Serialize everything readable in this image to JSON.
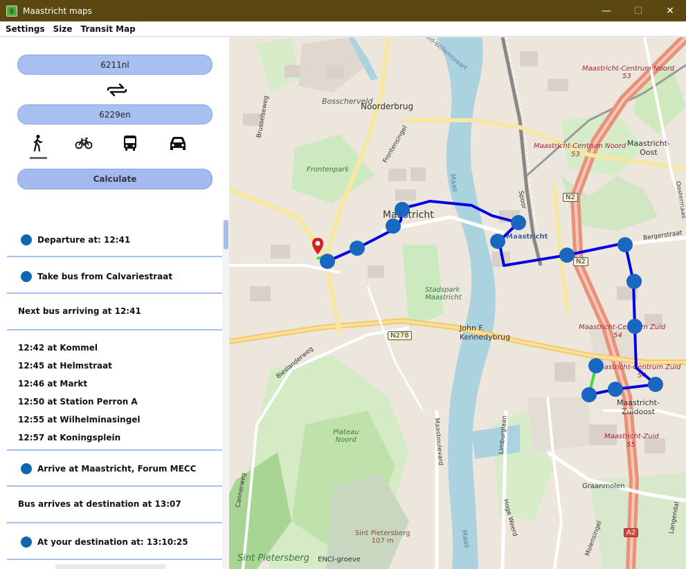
{
  "window": {
    "title": "Maastricht maps",
    "minimize": "—",
    "maximize": "☐",
    "close": "✕"
  },
  "menu": {
    "items": [
      "Settings",
      "Size",
      "Transit Map"
    ]
  },
  "form": {
    "from_value": "6211nl",
    "to_value": "6229en",
    "swap_icon": "swap-arrows-icon",
    "modes": [
      {
        "name": "walk",
        "icon": "walking-person-icon",
        "selected": true
      },
      {
        "name": "bike",
        "icon": "bicycle-icon",
        "selected": false
      },
      {
        "name": "bus",
        "icon": "bus-icon",
        "selected": false
      },
      {
        "name": "car",
        "icon": "car-icon",
        "selected": false
      }
    ],
    "calculate_label": "Calculate"
  },
  "itinerary": {
    "departure": "Departure at: 12:41",
    "take_bus": "Take bus from Calvariestraat",
    "next_bus": "Next bus arriving at 12:41",
    "stops": [
      "12:42 at Kommel",
      "12:45 at Helmstraat",
      "12:46 at Markt",
      "12:50 at Station Perron A",
      "12:55 at Wilhelminasingel",
      "12:57 at Koningsplein"
    ],
    "arrive": "Arrive at Maastricht, Forum MECC",
    "bus_arrives": "Bus arrives at destination at 13:07",
    "destination": "At your destination at: 13:10:25",
    "dot_color": "#1166b3",
    "separator_color": "#a8bff2"
  },
  "map": {
    "labels": {
      "bosscherveld": "Bosscherveld",
      "noorderbrug": "Noorderbrug",
      "maastricht": "Maastricht",
      "maastricht_station": "Maastricht",
      "frontenpark": "Frontenpark",
      "frontensingel": "Frontensingel",
      "brusselseweg": "Brusselseweg",
      "centrum_noord_top": "Maastricht-Centrum Noord",
      "centrum_noord_top_num": "53",
      "centrum_noord": "Maastricht-Centrum Noord",
      "centrum_noord_num": "53",
      "maastricht_oost": "Maastricht-\nOost",
      "bergerstraat": "Bergerstraat",
      "oostermaas": "Oostermaas",
      "maas1": "Maas",
      "maas2": "Maas",
      "stadspark": "Stadspark\nMaastricht",
      "john_f": "John F.\nKennedybrug",
      "bieslanderweg": "Bieslanderweg",
      "centrum_zuid_1": "Maastricht-Centrum Zuid",
      "centrum_zuid_1_num": "54",
      "centrum_zuid_2": "Maastricht-Centrum Zuid",
      "centrum_zuid_2_num": "54",
      "zuidoost": "Maastricht-\nZuidoost",
      "maastricht_zuid": "Maastricht-Zuid",
      "maastricht_zuid_num": "55",
      "plateau": "Plateau\nNoord",
      "maasboulevard": "Maasboulevard",
      "limburglaan": "Limburglaan",
      "graanmolen": "Graanmolen",
      "hoge_weerd": "Hoge Weerd",
      "sint_pietersberg_peak": "Sint Pietersberg\n107 m",
      "sint_pietersberg": "Sint Pietersberg",
      "enci": "ENCI-groeve",
      "cannerweg": "Cannerweg",
      "langendal": "Langendal",
      "molensingel": "Molensingel",
      "spoor": "Spoor",
      "kanaal": "Zuid-Willemsvaart"
    },
    "shields": {
      "n2": "N2",
      "n2b": "N2",
      "n278": "N278",
      "a2": "A2"
    },
    "route_color": "#0000e0",
    "stop_color": "#1a67c2",
    "walk_color": "#3cdc3c",
    "pin_color": "#d42020"
  }
}
